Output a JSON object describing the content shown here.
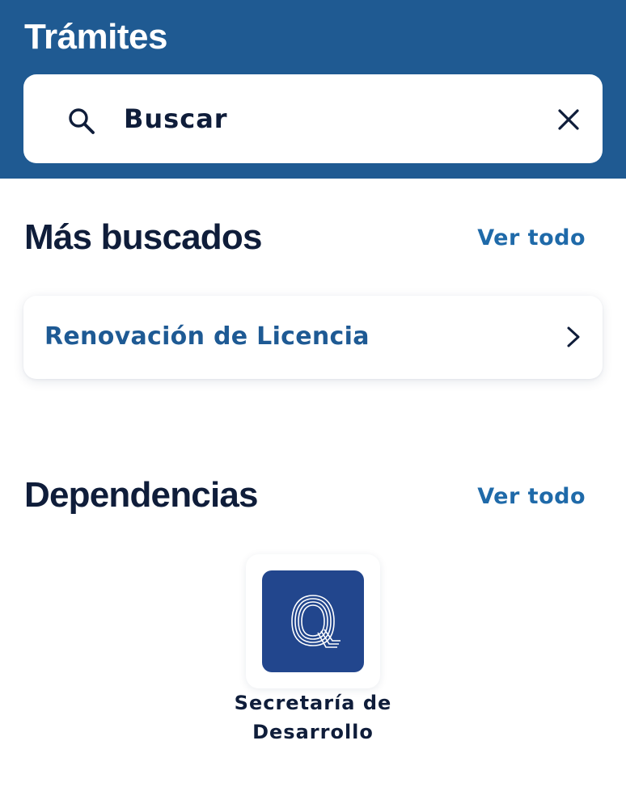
{
  "header": {
    "title": "Trámites"
  },
  "search": {
    "placeholder": "Buscar",
    "search_icon": "search-icon",
    "clear_icon": "close-icon"
  },
  "most_searched": {
    "title": "Más buscados",
    "see_all": "Ver todo",
    "items": [
      {
        "label": "Renovación de Licencia",
        "icon": "chevron-right-icon"
      }
    ]
  },
  "dependencies": {
    "title": "Dependencias",
    "see_all": "Ver todo",
    "items": [
      {
        "name": "Secretaría de Desarrollo",
        "logo_letter": "Q"
      }
    ]
  },
  "colors": {
    "header_bg": "#1f5a92",
    "accent": "#1f6aa9",
    "text_dark": "#0f1d3a",
    "logo_bg": "#22468d"
  }
}
